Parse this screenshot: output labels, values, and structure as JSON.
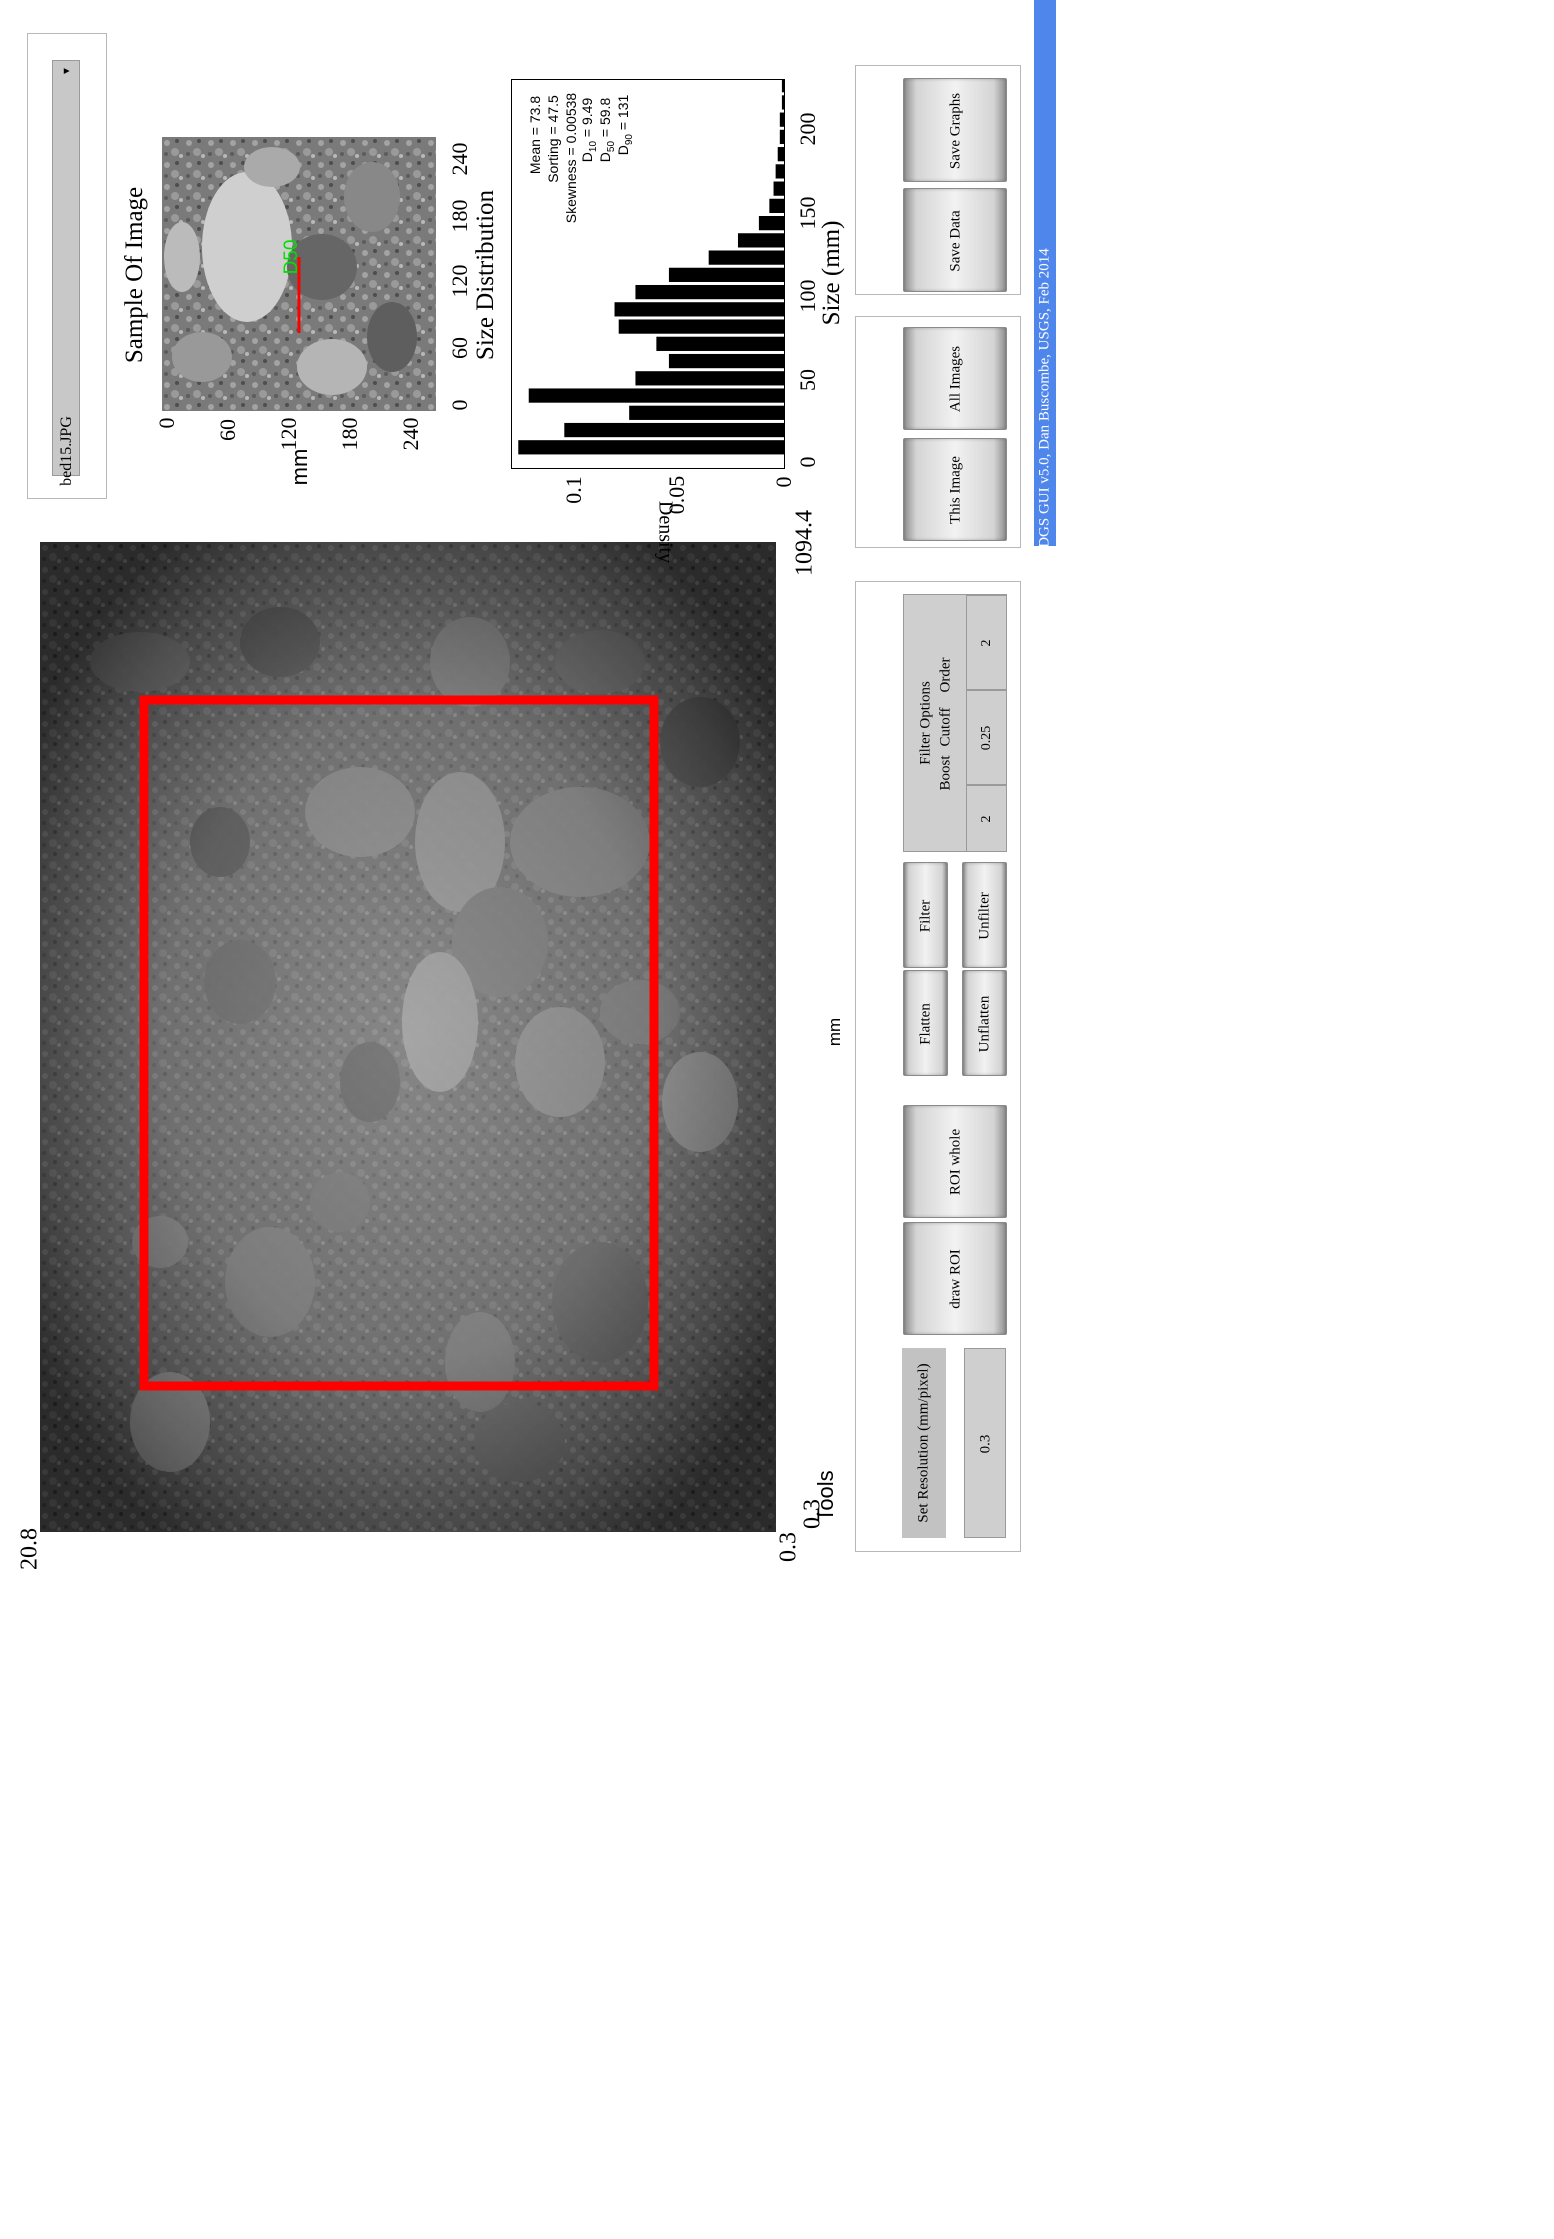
{
  "main_image": {
    "y_tick_top": "20.8",
    "y_tick_bottom": "0.3",
    "x_tick_left": "0.3",
    "x_tick_right": "1094.4",
    "axis_unit": "mm"
  },
  "file_selector": {
    "value": "bed15.JPG"
  },
  "sample_panel": {
    "title": "Sample Of Image",
    "ylabel": "mm",
    "marker_label": "D50",
    "yticks": [
      "0",
      "60",
      "120",
      "180",
      "240"
    ],
    "xticks": [
      "0",
      "60",
      "120",
      "180",
      "240"
    ]
  },
  "chart_data": {
    "type": "bar",
    "title": "Size Distribution",
    "xlabel": "Size (mm)",
    "ylabel": "Density",
    "xlim": [
      0,
      225
    ],
    "ylim": [
      0,
      0.13
    ],
    "xticks": [
      "0",
      "50",
      "100",
      "150",
      "200"
    ],
    "yticks": [
      "0",
      "0.05",
      "0.1"
    ],
    "x": [
      12,
      22,
      32,
      42,
      52,
      62,
      72,
      82,
      92,
      102,
      112,
      122,
      132,
      142,
      152,
      162,
      172,
      182,
      192,
      202,
      212,
      222
    ],
    "values": [
      0.127,
      0.105,
      0.074,
      0.122,
      0.071,
      0.055,
      0.061,
      0.079,
      0.081,
      0.071,
      0.055,
      0.036,
      0.022,
      0.012,
      0.007,
      0.005,
      0.004,
      0.003,
      0.002,
      0.002,
      0.001,
      0.001
    ],
    "stats": {
      "mean": "Mean = 73.8",
      "sorting": "Sorting = 47.5",
      "skewness": "Skewness = 0.00538",
      "d10_base": "D",
      "d10_sub": "10",
      "d10_val": " = 9.49",
      "d50_base": "D",
      "d50_sub": "50",
      "d50_val": " = 59.8",
      "d90_base": "D",
      "d90_sub": "90",
      "d90_val": " = 131"
    }
  },
  "tools": {
    "title": "Tools",
    "set_resolution_label": "Set Resolution (mm/pixel)",
    "resolution_value": "0.3",
    "draw_roi": "draw ROI",
    "roi_whole": "ROI whole",
    "flatten": "Flatten",
    "unflatten": "Unflatten",
    "filter": "Filter",
    "unfilter": "Unfilter",
    "filter_options": {
      "title": "Filter Options",
      "headers": [
        "Boost",
        "Cutoff",
        "Order"
      ],
      "values": [
        "2",
        "0.25",
        "2"
      ]
    }
  },
  "actions": {
    "this_image": "This Image",
    "all_images": "All Images",
    "save_data": "Save Data",
    "save_graphs": "Save Graphs"
  },
  "footer": {
    "credit": "DGS GUI v5.0, Dan Buscombe, USGS, Feb 2014",
    "color": "#4f86ec"
  }
}
